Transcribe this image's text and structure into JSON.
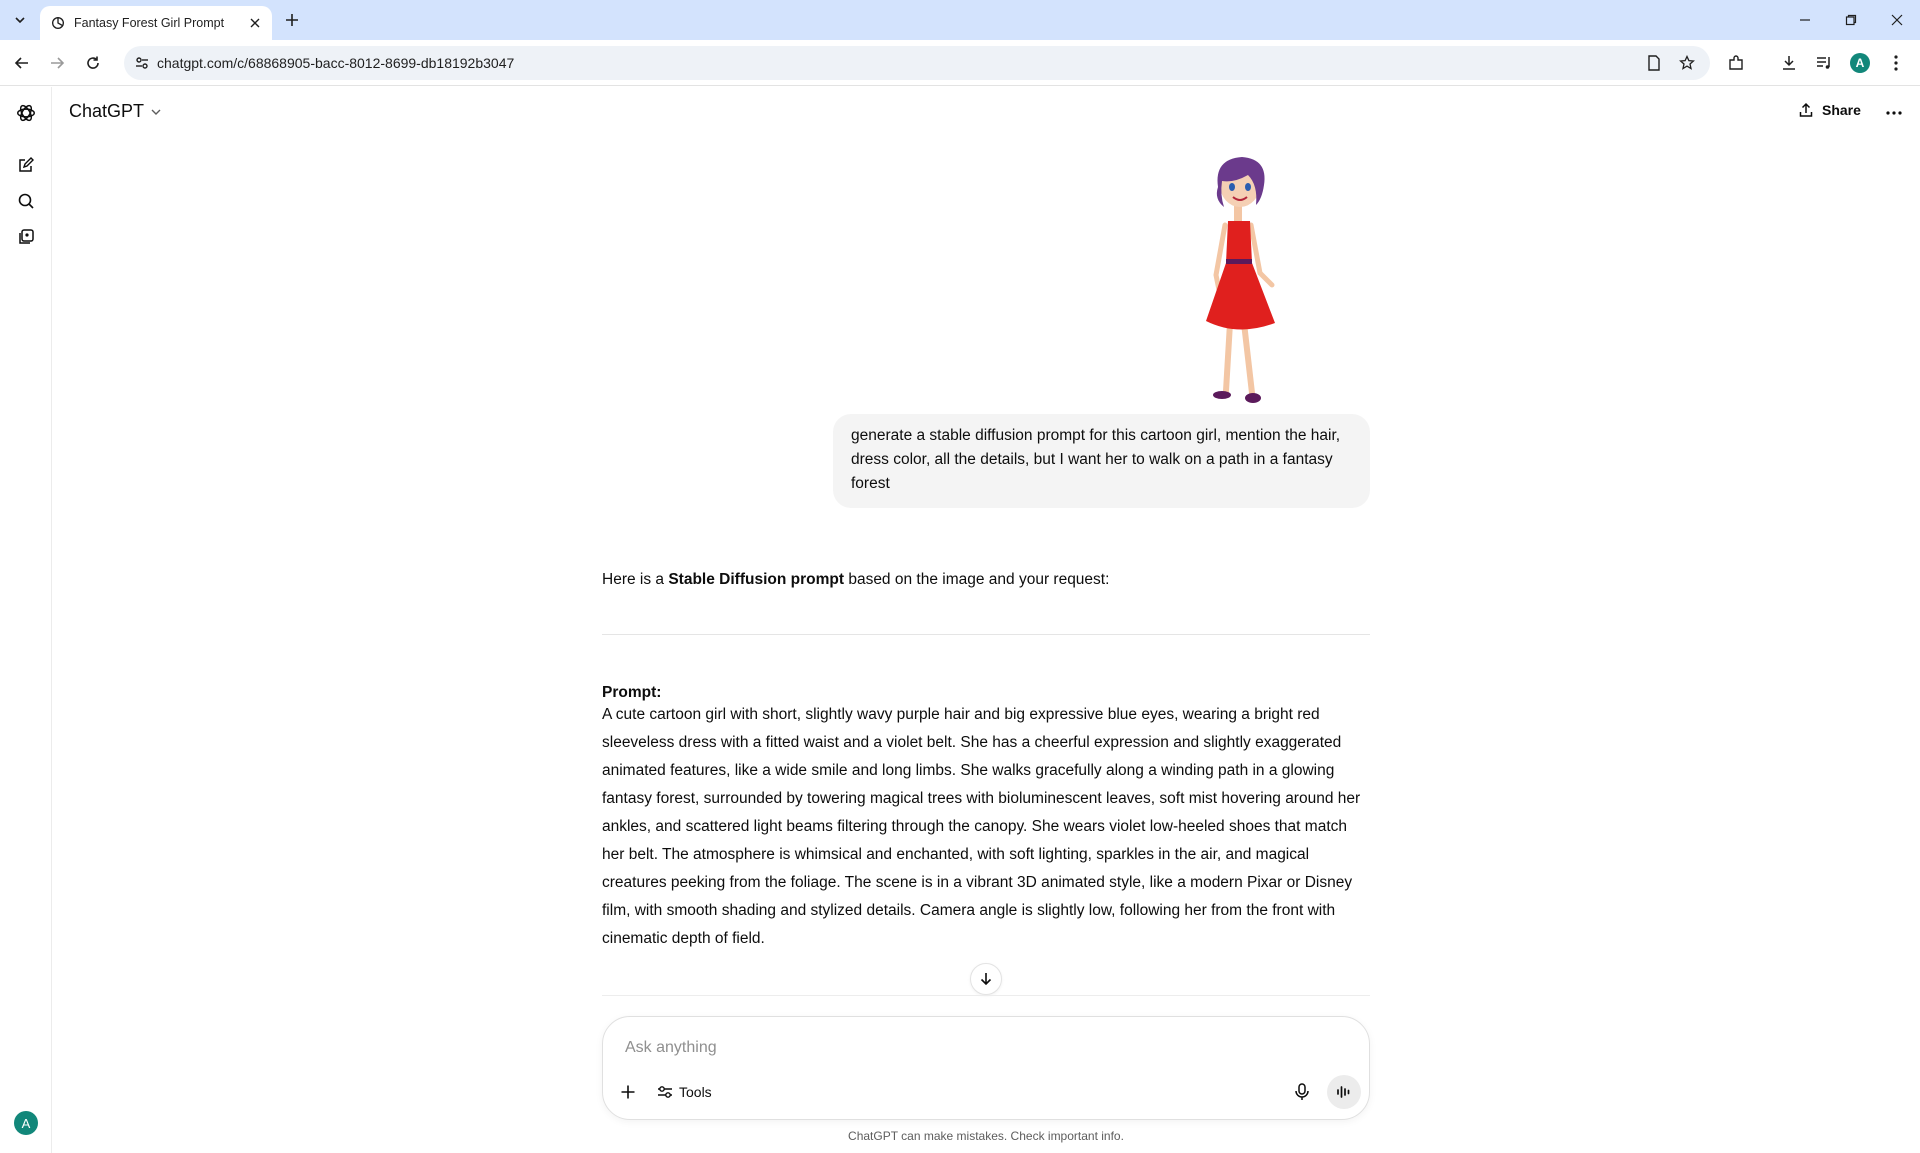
{
  "browser": {
    "tab_title": "Fantasy Forest Girl Prompt",
    "url": "chatgpt.com/c/68868905-bacc-8012-8699-db18192b3047",
    "profile_initial": "A"
  },
  "app": {
    "model_name": "ChatGPT",
    "share_label": "Share",
    "user_initial": "A"
  },
  "conversation": {
    "user_message": "generate a stable diffusion prompt for this cartoon girl, mention the hair, dress color, all the details, but  I want her to walk on a path in a fantasy forest",
    "assistant": {
      "intro_before": "Here is a ",
      "intro_bold": "Stable Diffusion prompt",
      "intro_after": " based on the image and your request:",
      "prompt_label": "Prompt:",
      "prompt_body": "A cute cartoon girl with short, slightly wavy purple hair and big expressive blue eyes, wearing a bright red sleeveless dress with a fitted waist and a violet belt. She has a cheerful expression and slightly exaggerated animated features, like a wide smile and long limbs. She walks gracefully along a winding path in a glowing fantasy forest, surrounded by towering magical trees with bioluminescent leaves, soft mist hovering around her ankles, and scattered light beams filtering through the canopy. She wears violet low-heeled shoes that match her belt. The atmosphere is whimsical and enchanted, with soft lighting, sparkles in the air, and magical creatures peeking from the foliage. The scene is in a vibrant 3D animated style, like a modern Pixar or Disney film, with smooth shading and stylized details. Camera angle is slightly low, following her from the front with cinematic depth of field."
    }
  },
  "composer": {
    "placeholder": "Ask anything",
    "tools_label": "Tools",
    "disclaimer": "ChatGPT can make mistakes. Check important info."
  },
  "colors": {
    "tabstrip_bg": "#d3e3fd",
    "avatar_bg": "#12877a",
    "bubble_bg": "#f4f4f4",
    "dress_red": "#e0201e",
    "hair_purple": "#6b3a8c"
  },
  "icons": [
    "tab-search-icon",
    "openai-logo-icon",
    "close-icon",
    "plus-icon",
    "minimize-icon",
    "restore-icon",
    "back-arrow-icon",
    "forward-arrow-icon",
    "reload-icon",
    "site-settings-icon",
    "page-icon",
    "star-icon",
    "extensions-icon",
    "download-icon",
    "media-icon",
    "kebab-menu-icon",
    "new-chat-icon",
    "search-icon",
    "library-icon",
    "chevron-down-icon",
    "share-icon",
    "more-icon",
    "arrow-down-icon",
    "tools-icon",
    "mic-icon",
    "voice-mode-icon"
  ]
}
